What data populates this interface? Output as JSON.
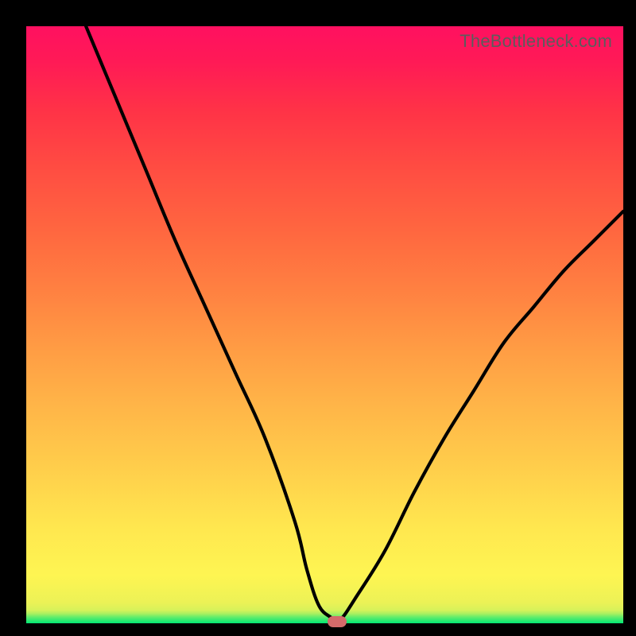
{
  "watermark": "TheBottleneck.com",
  "chart_data": {
    "type": "line",
    "title": "",
    "xlabel": "",
    "ylabel": "",
    "xlim": [
      0,
      100
    ],
    "ylim": [
      0,
      100
    ],
    "grid": false,
    "legend": false,
    "series": [
      {
        "name": "bottleneck-curve",
        "x": [
          10,
          15,
          20,
          25,
          30,
          35,
          40,
          45,
          47,
          49,
          51,
          52,
          53,
          55,
          60,
          65,
          70,
          75,
          80,
          85,
          90,
          95,
          100
        ],
        "y": [
          100,
          88,
          76,
          64,
          53,
          42,
          31,
          17,
          9,
          3,
          1,
          0.5,
          1,
          4,
          12,
          22,
          31,
          39,
          47,
          53,
          59,
          64,
          69
        ]
      }
    ],
    "annotations": [
      {
        "name": "optimal-marker",
        "x": 52,
        "y": 0.3,
        "shape": "pill",
        "color": "#d46a6a"
      }
    ],
    "background_gradient": {
      "orientation": "vertical",
      "stops": [
        {
          "pos": 0.0,
          "color": "#00e874"
        },
        {
          "pos": 0.08,
          "color": "#fef552"
        },
        {
          "pos": 0.5,
          "color": "#ff9040"
        },
        {
          "pos": 1.0,
          "color": "#ff1258"
        }
      ]
    },
    "watermark_text": "TheBottleneck.com"
  }
}
